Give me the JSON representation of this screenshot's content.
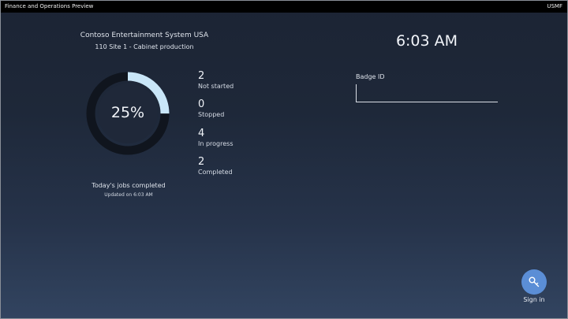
{
  "topbar": {
    "app_title": "Finance and Operations Preview",
    "company": "USMF"
  },
  "header": {
    "organization": "Contoso Entertainment System USA",
    "site": "110 Site 1 - Cabinet production"
  },
  "progress": {
    "percent_label": "25%",
    "fraction_completed": 0.25,
    "caption": "Today's jobs completed",
    "updated": "Updated on 6:03 AM",
    "colors": {
      "fill": "#c9e6f8",
      "track": "#10151e",
      "inner": "#1f2839"
    }
  },
  "stats": [
    {
      "value": "2",
      "label": "Not started"
    },
    {
      "value": "0",
      "label": "Stopped"
    },
    {
      "value": "4",
      "label": "In progress"
    },
    {
      "value": "2",
      "label": "Completed"
    }
  ],
  "clock": {
    "time": "6:03 AM"
  },
  "badge": {
    "label": "Badge ID",
    "value": ""
  },
  "signin": {
    "label": "Sign in",
    "icon": "key-icon",
    "color": "#5b8ed6"
  }
}
